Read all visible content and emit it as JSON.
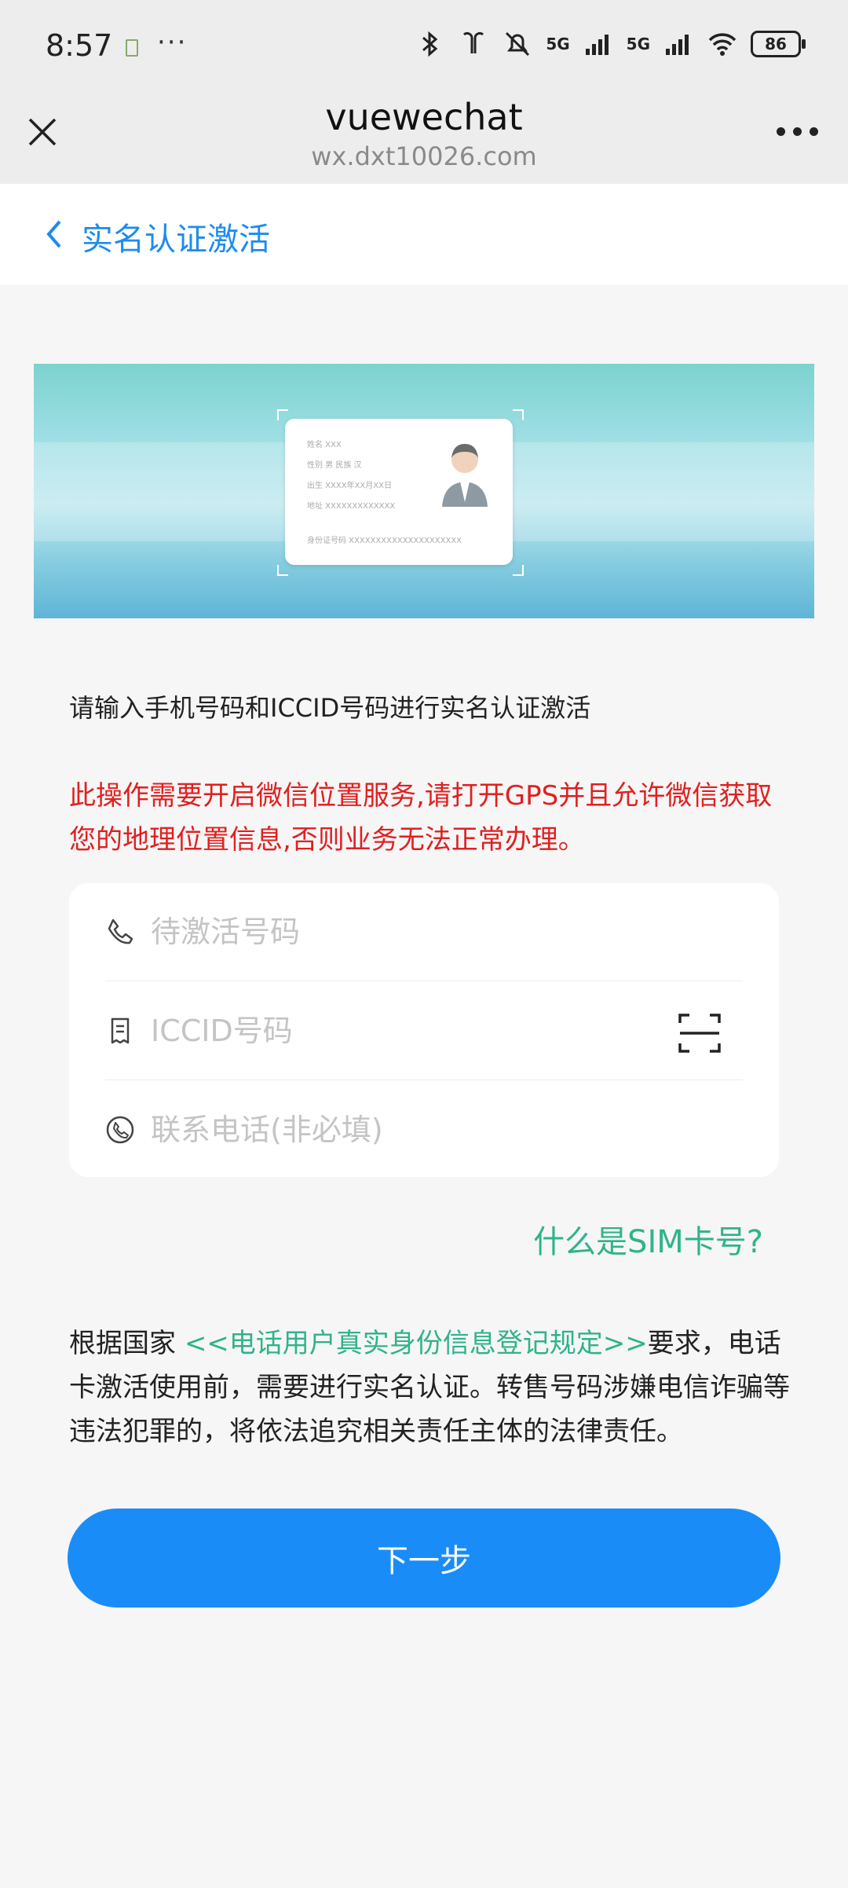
{
  "status_bar": {
    "time": "8:57",
    "more": "···",
    "signal1": "5G",
    "signal2": "5G",
    "battery": "86"
  },
  "browser": {
    "title": "vuewechat",
    "url": "wx.dxt10026.com"
  },
  "page": {
    "title": "实名认证激活"
  },
  "banner": {
    "card_lines": [
      "姓名   XXX",
      "性别   男     民族   汉",
      "出生   XXXX年XX月XX日",
      "地址   XXXXXXXXXXXXX",
      "身份证号码   XXXXXXXXXXXXXXXXXXXXX"
    ]
  },
  "intro_text": "请输入手机号码和ICCID号码进行实名认证激活",
  "warning_text": "此操作需要开启微信位置服务,请打开GPS并且允许微信获取您的地理位置信息,否则业务无法正常办理。",
  "form": {
    "phone_placeholder": "待激活号码",
    "iccid_placeholder": "ICCID号码",
    "contact_placeholder": "联系电话(非必填)"
  },
  "sim_help_link": "什么是SIM卡号?",
  "rule": {
    "prefix": "根据国家 ",
    "link": "<<电话用户真实身份信息登记规定>>",
    "suffix": "要求，电话卡激活使用前，需要进行实名认证。转售号码涉嫌电信诈骗等违法犯罪的，将依法追究相关责任主体的法律责任。"
  },
  "next_button": "下一步",
  "colors": {
    "accent": "#1a8cf8",
    "link_green": "#2fb38a",
    "warning_red": "#e02020"
  }
}
